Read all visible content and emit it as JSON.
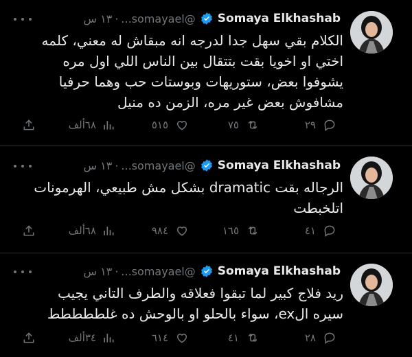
{
  "colors": {
    "background": "#000000",
    "text": "#e7e9ea",
    "muted": "#71767b",
    "verified": "#1d9bf0",
    "divider": "#2f3336"
  },
  "tweets": [
    {
      "name": "Somaya Elkhashab",
      "handle": "@somayael...",
      "time": "١٣ س",
      "lines": [
        "الكلام بقي سهل جدا لدرجه انه مبقاش له معني، كلمه",
        "اختي او اخويا بقت بتتقال بين الناس اللي اول مره",
        "يشوفوا بعض، ستوريهات وبوستات حب وهما حرفيا",
        "مشافوش بعض غير مره، الزمن ده منيل"
      ],
      "replies": "٢٩",
      "retweets": "٧٥",
      "likes": "٥١٥",
      "views": "٦٨ألف"
    },
    {
      "name": "Somaya Elkhashab",
      "handle": "@somayael...",
      "time": "١٣ س",
      "lines": [
        "الرجاله بقت dramatic بشكل مش طبيعي، الهرمونات",
        "اتلخبطت"
      ],
      "replies": "٤١",
      "retweets": "١٦٥",
      "likes": "٩٨٤",
      "views": "٦٨ألف"
    },
    {
      "name": "Somaya Elkhashab",
      "handle": "@somayael...",
      "time": "١٣ س",
      "lines": [
        "ريد فلاج كبير لما تبقوا فعلاقه والطرف التاني يجيب",
        "سيره الex، سواء بالحلو او بالوحش ده غلططططط"
      ],
      "replies": "٢٨",
      "retweets": "٤١",
      "likes": "٦١٤",
      "views": "٣٤ألف"
    }
  ],
  "icons": {
    "avatar": "profile-photo",
    "verified": "verified-badge-icon",
    "more": "more-options-icon",
    "reply": "reply-icon",
    "retweet": "retweet-icon",
    "like": "heart-icon",
    "views": "views-chart-icon",
    "share": "share-icon"
  }
}
